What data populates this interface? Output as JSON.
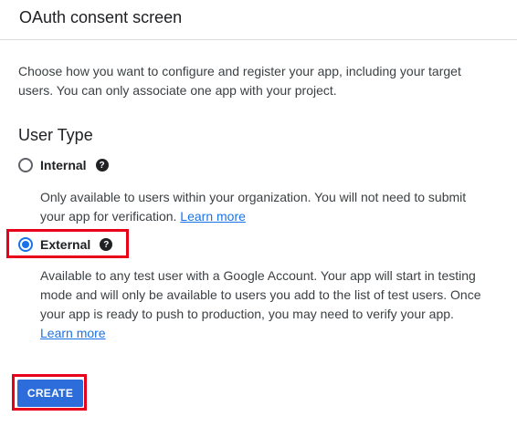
{
  "header": {
    "title": "OAuth consent screen"
  },
  "description": "Choose how you want to configure and register your app, including your target users. You can only associate one app with your project.",
  "user_type": {
    "title": "User Type",
    "options": [
      {
        "label": "Internal",
        "selected": false,
        "description": "Only available to users within your organization. You will not need to submit your app for verification.",
        "link": "Learn more"
      },
      {
        "label": "External",
        "selected": true,
        "description": "Available to any test user with a Google Account. Your app will start in testing mode and will only be available to users you add to the list of test users. Once your app is ready to push to production, you may need to verify your app.",
        "link": "Learn more"
      }
    ]
  },
  "actions": {
    "create_label": "CREATE"
  },
  "colors": {
    "accent": "#1a73e8",
    "button": "#2d6cdb",
    "highlight": "#e8001a"
  }
}
